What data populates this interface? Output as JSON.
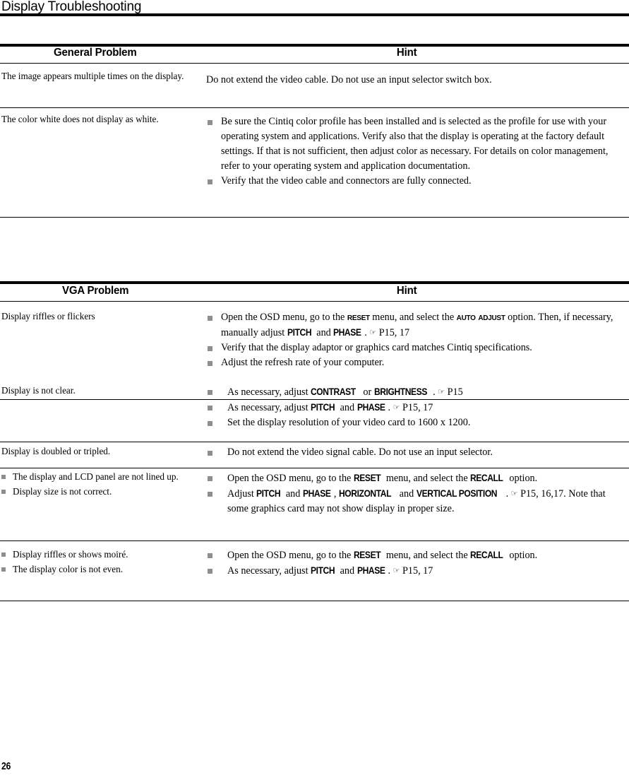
{
  "document": {
    "running_head": "Display Troubleshooting",
    "folio": "26"
  },
  "tables": [
    {
      "id": "general",
      "headers": {
        "problem": "General Problem",
        "hint": "Hint"
      },
      "rows": [
        {
          "problem": "The image appears multiple times on the display.",
          "hint_plain": "Do not extend the video cable. Do not use an input selector switch box."
        },
        {
          "problem": "The color white does not display as white.",
          "hint_bullets": [
            "Be sure the Cintiq color profile has been installed and is selected as the profile for use with your operating system and applications.  Verify also that the display is operating at the factory default settings.  If that is not sufficient, then adjust color as necessary.  For details on color management, refer to your operating system and application documentation.",
            "Verify that the video cable and connectors are fully connected."
          ]
        }
      ]
    },
    {
      "id": "vga",
      "headers": {
        "problem": "VGA Problem",
        "hint": "Hint"
      },
      "rows": [
        {
          "problem": "Display riffles or flickers",
          "hint_bullets": [
            {
              "parts": [
                {
                  "t": "Open the OSD menu, go to the "
                },
                {
                  "t": "Reset",
                  "style": "osd-sc"
                },
                {
                  "t": " menu, and select the "
                },
                {
                  "t": "Auto Adjust",
                  "style": "osd-sc"
                },
                {
                  "t": " option.  Then, if necessary, manually adjust "
                },
                {
                  "t": "PITCH",
                  "style": "osd"
                },
                {
                  "t": " and "
                },
                {
                  "t": "PHASE",
                  "style": "osd"
                },
                {
                  "t": ". "
                },
                {
                  "t": "☞",
                  "style": "hand"
                },
                {
                  "t": " P15, 17"
                }
              ]
            },
            {
              "parts": [
                {
                  "t": "Verify that the display adaptor or graphics card matches Cintiq specifications."
                }
              ]
            },
            {
              "parts": [
                {
                  "t": "Adjust the refresh rate of your computer."
                }
              ]
            }
          ]
        },
        {
          "problem": "Display is not clear.",
          "hint_bullets": [
            {
              "indent": true,
              "parts": [
                {
                  "t": "As necessary, adjust "
                },
                {
                  "t": "CONTRAST",
                  "style": "osd"
                },
                {
                  "t": " or "
                },
                {
                  "t": "BRIGHTNESS",
                  "style": "osd"
                },
                {
                  "t": ". "
                },
                {
                  "t": "☞",
                  "style": "hand"
                },
                {
                  "t": " P15"
                }
              ]
            },
            {
              "indent": true,
              "parts": [
                {
                  "t": "As necessary, adjust "
                },
                {
                  "t": "PITCH",
                  "style": "osd"
                },
                {
                  "t": " and "
                },
                {
                  "t": "PHASE",
                  "style": "osd"
                },
                {
                  "t": ". "
                },
                {
                  "t": "☞",
                  "style": "hand"
                },
                {
                  "t": " P15, 17"
                }
              ]
            },
            {
              "indent": true,
              "parts": [
                {
                  "t": "Set the display resolution of your video card to 1600 x 1200."
                }
              ]
            }
          ]
        },
        {
          "problem": "Display is doubled or tripled.",
          "hint_bullets": [
            {
              "indent": true,
              "parts": [
                {
                  "t": "Do not extend the video signal cable. Do not use an input selector."
                }
              ]
            }
          ]
        },
        {
          "problem_bullets": [
            "The display and LCD panel are not lined up.",
            "Display size is not correct."
          ],
          "hint_bullets": [
            {
              "indent": true,
              "parts": [
                {
                  "t": "Open the OSD menu, go to the "
                },
                {
                  "t": "RESET",
                  "style": "osd"
                },
                {
                  "t": " menu, and select the "
                },
                {
                  "t": "RECALL",
                  "style": "osd"
                },
                {
                  "t": " option."
                }
              ]
            },
            {
              "indent": true,
              "parts": [
                {
                  "t": "Adjust "
                },
                {
                  "t": "PITCH",
                  "style": "osd"
                },
                {
                  "t": " and "
                },
                {
                  "t": "PHASE",
                  "style": "osd"
                },
                {
                  "t": ", "
                },
                {
                  "t": "HORIZONTAL",
                  "style": "osd"
                },
                {
                  "t": " and "
                },
                {
                  "t": "VERTICAL POSITION",
                  "style": "osd"
                },
                {
                  "t": ". "
                },
                {
                  "t": "☞",
                  "style": "hand"
                },
                {
                  "t": " P15, 16,17. Note that some graphics card may not show display in proper size."
                }
              ]
            }
          ]
        },
        {
          "problem_bullets": [
            "Display riffles or shows moiré.",
            "The display color is not even."
          ],
          "hint_bullets": [
            {
              "indent": true,
              "parts": [
                {
                  "t": "Open the OSD menu, go to the "
                },
                {
                  "t": "RESET",
                  "style": "osd"
                },
                {
                  "t": " menu, and select the "
                },
                {
                  "t": "RECALL",
                  "style": "osd"
                },
                {
                  "t": " option."
                }
              ]
            },
            {
              "indent": true,
              "parts": [
                {
                  "t": "As necessary, adjust "
                },
                {
                  "t": "PITCH",
                  "style": "osd"
                },
                {
                  "t": " and "
                },
                {
                  "t": "PHASE",
                  "style": "osd"
                },
                {
                  "t": ". "
                },
                {
                  "t": "☞",
                  "style": "hand"
                },
                {
                  "t": " P15, 17"
                }
              ]
            }
          ]
        }
      ]
    }
  ]
}
